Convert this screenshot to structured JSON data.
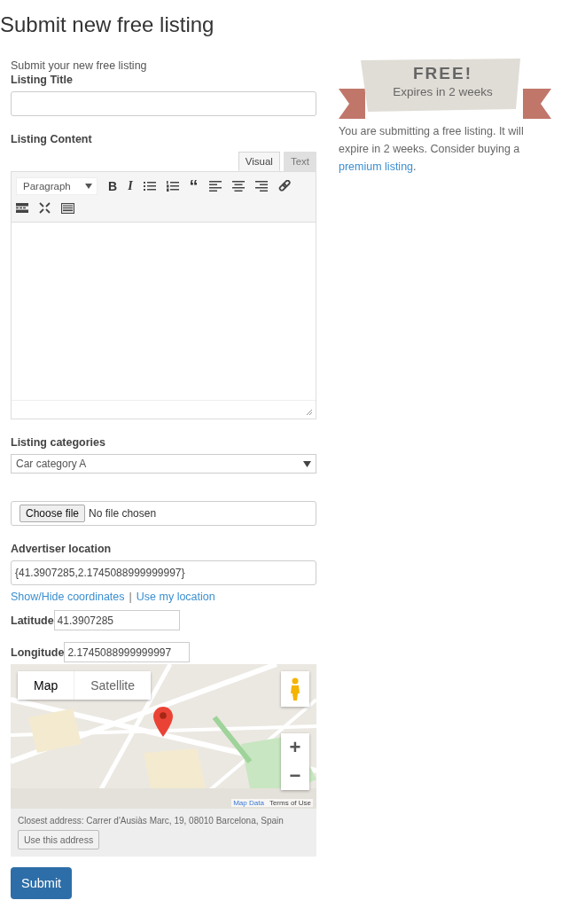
{
  "page_title": "Submit new free listing",
  "intro": "Submit your new free listing",
  "title_field": {
    "label": "Listing Title"
  },
  "content_field": {
    "label": "Listing Content",
    "tabs": [
      {
        "label": "Visual",
        "selected": true
      },
      {
        "label": "Text",
        "selected": false
      }
    ],
    "format_select": "Paragraph",
    "toolbar": [
      {
        "kind": "bold",
        "glyph": "B"
      },
      {
        "kind": "italic",
        "glyph": "I"
      },
      {
        "kind": "bullets"
      },
      {
        "kind": "numbers"
      },
      {
        "kind": "quote",
        "glyph": "“"
      },
      {
        "kind": "align-left"
      },
      {
        "kind": "align-center"
      },
      {
        "kind": "align-right"
      },
      {
        "kind": "link"
      },
      {
        "kind": "more"
      },
      {
        "kind": "fullscreen"
      },
      {
        "kind": "keyboard"
      }
    ]
  },
  "categories": {
    "label": "Listing categories",
    "value": "Car category A"
  },
  "file_field": {
    "button": "Choose file",
    "status": "No file chosen"
  },
  "location": {
    "label": "Advertiser location",
    "value": "{41.3907285,2.1745088999999997}",
    "links": [
      "Show/Hide coordinates",
      "Use my location"
    ],
    "link_separator": "|",
    "latitude": {
      "label": "Latitude",
      "value": "41.3907285"
    },
    "longitude": {
      "label": "Longitude",
      "value": "2.1745088999999997"
    }
  },
  "map": {
    "kind": "picture",
    "types": [
      {
        "label": "Map",
        "selected": true
      },
      {
        "label": "Satellite",
        "selected": false
      }
    ],
    "zoom_in": "+",
    "zoom_out": "−",
    "attribution": [
      "Map Data",
      "Terms of Use"
    ],
    "closest_address": "Closest address: Carrer d'Ausiàs Marc, 19, 08010 Barcelona, Spain",
    "use_address": "Use this address"
  },
  "submit": "Submit",
  "promo": {
    "ribbon_title": "FREE!",
    "ribbon_subtitle": "Expires in 2 weeks",
    "text": "You are submitting a free listing. It will expire in 2 weeks. Consider buying a",
    "link": "premium listing",
    "after": "."
  }
}
